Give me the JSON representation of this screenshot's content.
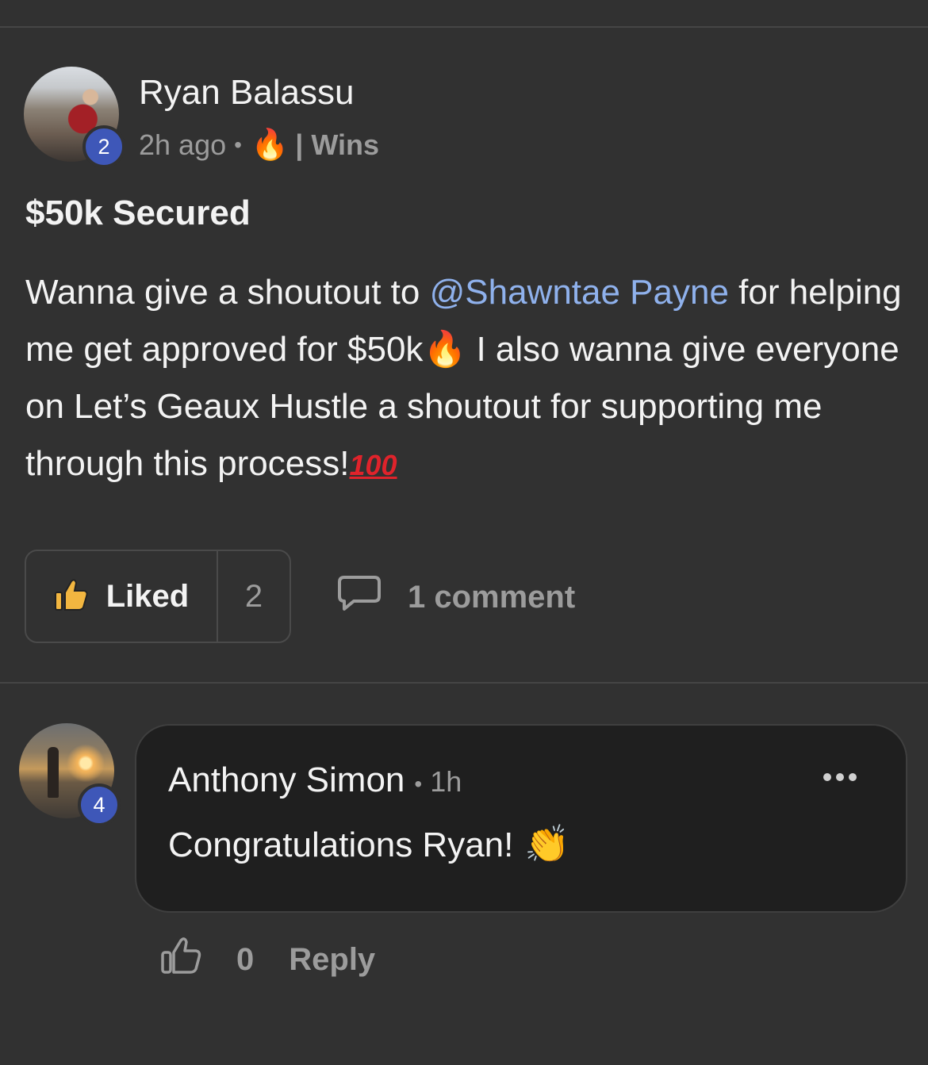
{
  "post": {
    "author": "Ryan Balassu",
    "author_level": "2",
    "time": "2h ago",
    "category_emoji": "🔥",
    "category": "| Wins",
    "title": "$50k Secured",
    "body": {
      "part1": "Wanna give a shoutout to ",
      "mention": "@Shawntae Payne",
      "part2": " for helping me get approved for $50k",
      "emoji1": "🔥",
      "part3": " I also wanna give everyone on Let’s Geaux Hustle a shoutout for supporting me through this process!",
      "emoji2": "100"
    },
    "like_label": "Liked",
    "like_count": "2",
    "comments_label": "1 comment"
  },
  "comment": {
    "author": "Anthony Simon",
    "author_level": "4",
    "time": "1h",
    "text": "Congratulations Ryan!",
    "emoji": "👏",
    "like_count": "0",
    "reply_label": "Reply"
  },
  "colors": {
    "background": "#313131",
    "mention": "#8fb1ec",
    "level_badge": "#3e57b8",
    "comment_bubble": "#1f1f1f",
    "like_icon": "#f2b640"
  },
  "icons": {
    "liked": "thumbs-up-filled-icon",
    "comments": "chat-bubble-icon",
    "comment_like": "thumbs-up-outline-icon",
    "more": "more-horizontal-icon"
  }
}
